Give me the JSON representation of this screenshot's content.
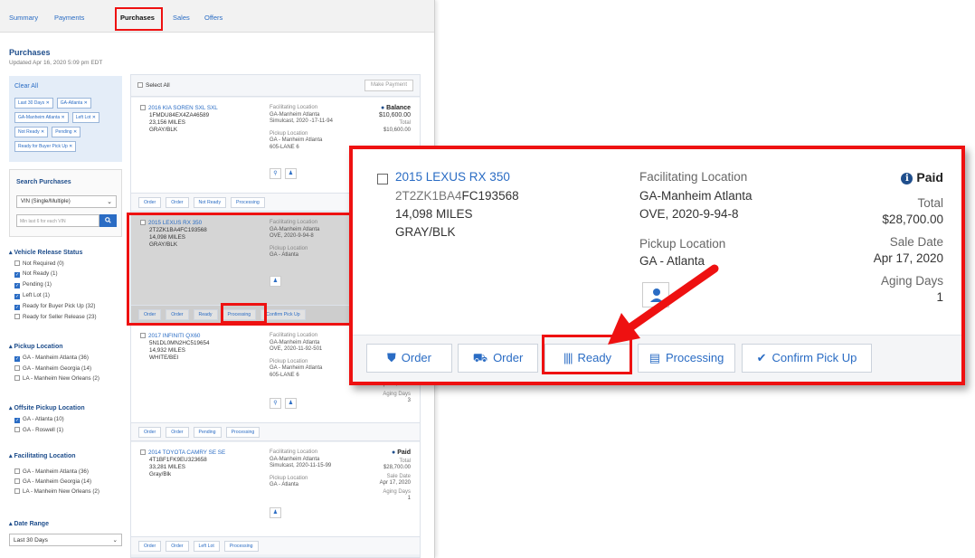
{
  "tabs": [
    {
      "label": "Summary",
      "active": false
    },
    {
      "label": "Payments",
      "active": false
    },
    {
      "label": "Purchases",
      "active": true
    },
    {
      "label": "Sales",
      "active": false
    },
    {
      "label": "Offers",
      "active": false
    }
  ],
  "page": {
    "title": "Purchases",
    "updated": "Updated Apr 16, 2020 5:09 pm EDT"
  },
  "filters": {
    "clear_all": "Clear All",
    "chips": [
      "Last 30 Days ✕",
      "GA-Atlanta ✕",
      "GA-Manheim Atlanta ✕",
      "Left Lot ✕",
      "Not Ready ✕",
      "Pending ✕",
      "Ready for Buyer Pick Up ✕"
    ]
  },
  "search": {
    "title": "Search Purchases",
    "select_value": "VIN (Single/Multiple)",
    "placeholder": "Min last 6 for each VIN"
  },
  "sections": {
    "release": {
      "title": "Vehicle Release Status",
      "options": [
        {
          "label": "Not Required (0)",
          "checked": false
        },
        {
          "label": "Not Ready (1)",
          "checked": true
        },
        {
          "label": "Pending (1)",
          "checked": true
        },
        {
          "label": "Left Lot (1)",
          "checked": true
        },
        {
          "label": "Ready for Buyer Pick Up (32)",
          "checked": true
        },
        {
          "label": "Ready for Seller Release (23)",
          "checked": false
        }
      ]
    },
    "pickup": {
      "title": "Pickup Location",
      "options": [
        {
          "label": "GA - Manheim Atlanta (36)",
          "checked": true
        },
        {
          "label": "GA - Manheim Georgia (14)",
          "checked": false
        },
        {
          "label": "LA - Manheim New Orleans (2)",
          "checked": false
        }
      ]
    },
    "offsite": {
      "title": "Offsite Pickup Location",
      "options": [
        {
          "label": "GA - Atlanta (10)",
          "checked": true
        },
        {
          "label": "GA - Roswell (1)",
          "checked": false
        }
      ]
    },
    "facilitating": {
      "title": "Facilitating Location",
      "options": [
        {
          "label": "GA - Manheim Atlanta (36)",
          "checked": false
        },
        {
          "label": "GA - Manheim Georgia (14)",
          "checked": false
        },
        {
          "label": "LA - Manheim New Orleans (2)",
          "checked": false
        }
      ]
    },
    "date": {
      "title": "Date Range",
      "select_value": "Last 30 Days"
    }
  },
  "results": {
    "select_all": "Select All",
    "make_payment": "Make Payment",
    "cards": [
      {
        "title": "2016 KIA SOREN SXL SXL",
        "vin": "1FMDU84EX4ZA46589",
        "miles": "23,156 MILES",
        "color": "GRAY/BLK",
        "fac_label": "Facilitating Location",
        "fac_value": "GA-Manheim Atlanta",
        "fac_sub": "Simulcast, 2020 -17-11-94",
        "pu_label": "Pickup Location",
        "pu_value": "GA - Manheim Atlanta",
        "pu_sub": "605-LANE 6",
        "status": "Balance",
        "amount": "$10,600.00",
        "total_label": "Total",
        "total": "$10,600.00",
        "actions": [
          "Order",
          "Order",
          "Not Ready",
          "Processing"
        ]
      },
      {
        "title": "2015 LEXUS RX 350",
        "vin": "2T2ZK1BA4FC193568",
        "miles": "14,098 MILES",
        "color": "GRAY/BLK",
        "fac_label": "Facilitating Location",
        "fac_value": "GA-Manheim Atlanta",
        "fac_sub": "OVE, 2020-9-94-8",
        "pu_label": "Pickup Location",
        "pu_value": "GA - Atlanta",
        "actions": [
          "Order",
          "Order",
          "Ready",
          "Processing",
          "Confirm Pick Up"
        ]
      },
      {
        "title": "2017 INFINITI QX60",
        "vin": "5N1DL0MN2HC519654",
        "miles": "14,932 MILES",
        "color": "WHITE/BEI",
        "fac_label": "Facilitating Location",
        "fac_value": "GA-Manheim Atlanta",
        "fac_sub": "OVE, 2020-11-92-501",
        "pu_label": "Pickup Location",
        "pu_value": "GA - Manheim Atlanta",
        "pu_sub": "605-LANE 6",
        "sale_date": "Apr 17, 2020",
        "aging_label": "Aging Days",
        "aging": "3",
        "actions": [
          "Order",
          "Order",
          "Pending",
          "Processing"
        ]
      },
      {
        "title": "2014 TOYOTA CAMRY SE SE",
        "vin": "4T1BF1FK9EU323658",
        "miles": "33,281 MILES",
        "color": "Gray/Blk",
        "fac_label": "Facilitating Location",
        "fac_value": "GA-Manheim Atlanta",
        "fac_sub": "Simulcast, 2020-11-15-99",
        "pu_label": "Pickup Location",
        "pu_value": "GA - Atlanta",
        "status": "Paid",
        "total_label": "Total",
        "total": "$28,700.00",
        "sale_label": "Sale Date",
        "sale_date": "Apr 17, 2020",
        "aging_label": "Aging Days",
        "aging": "1",
        "actions": [
          "Order",
          "Order",
          "Left Lot",
          "Processing"
        ]
      }
    ]
  },
  "zoom": {
    "title": "2015 LEXUS RX 350",
    "vin_prefix": "2T2ZK1BA4",
    "vin_suffix": "FC193568",
    "miles": "14,098 MILES",
    "color": "GRAY/BLK",
    "fac_label": "Facilitating Location",
    "fac_value": "GA-Manheim Atlanta",
    "fac_sub": "OVE, 2020-9-94-8",
    "pu_label": "Pickup Location",
    "pu_value": "GA - Atlanta",
    "status": "Paid",
    "total_label": "Total",
    "total": "$28,700.00",
    "sale_label": "Sale Date",
    "sale_date": "Apr 17, 2020",
    "aging_label": "Aging Days",
    "aging": "1",
    "actions": {
      "order1": "Order",
      "order2": "Order",
      "ready": "Ready",
      "processing": "Processing",
      "confirm": "Confirm Pick Up"
    }
  },
  "colors": {
    "accent": "#2a6cc4",
    "highlight": "#e11111",
    "header_blue": "#1f4e8c"
  },
  "icons": [
    "shield-icon",
    "truck-icon",
    "barcode-icon",
    "document-icon",
    "check-icon",
    "info-icon",
    "person-icon",
    "location-pin-icon",
    "search-icon",
    "chevron-down-icon"
  ]
}
